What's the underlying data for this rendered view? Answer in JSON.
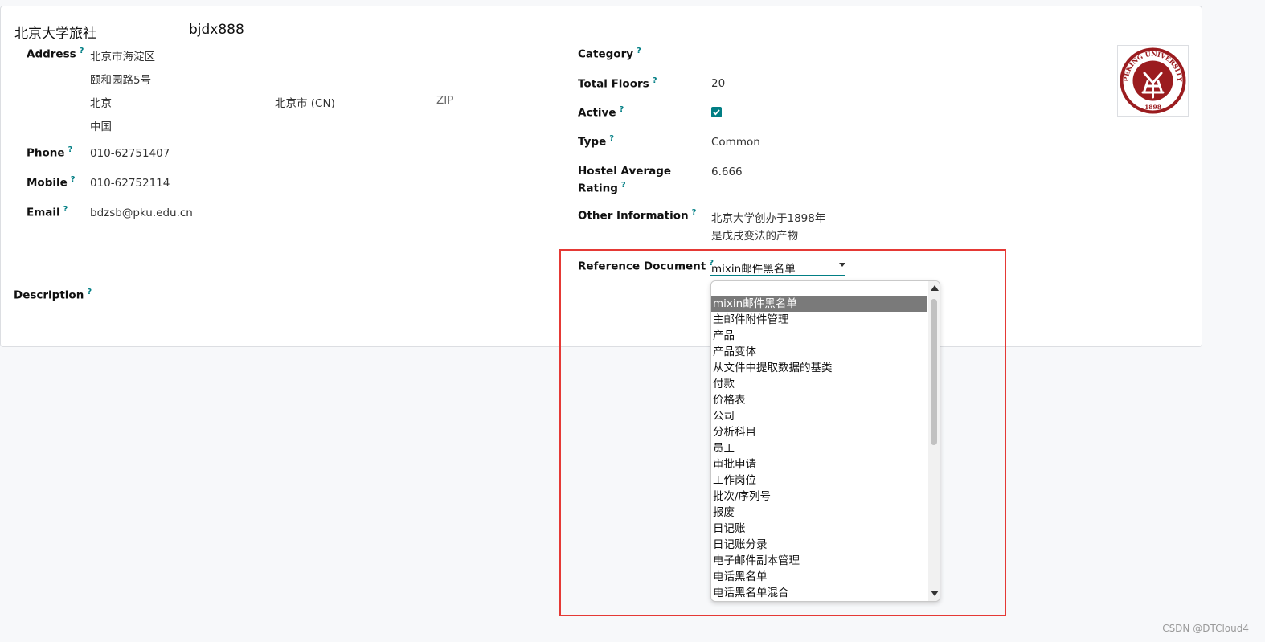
{
  "record": {
    "name": "北京大学旅社",
    "code": "bjdx888"
  },
  "left": {
    "address_label": "Address",
    "address_line1": "北京市海淀区",
    "address_line2": "颐和园路5号",
    "city": "北京",
    "state": "北京市 (CN)",
    "zip_placeholder": "ZIP",
    "country": "中国",
    "phone_label": "Phone",
    "phone": "010-62751407",
    "mobile_label": "Mobile",
    "mobile": "010-62752114",
    "email_label": "Email",
    "email": "bdzsb@pku.edu.cn",
    "description_label": "Description"
  },
  "right": {
    "category_label": "Category",
    "floors_label": "Total Floors",
    "floors": "20",
    "active_label": "Active",
    "active": true,
    "type_label": "Type",
    "type": "Common",
    "rating_label_line1": "Hostel Average",
    "rating_label_line2": "Rating",
    "rating": "6.666",
    "other_label": "Other Information",
    "other_line1": "北京大学创办于1898年",
    "other_line2": "是戊戌变法的产物",
    "ref_label": "Reference Document",
    "ref_value": "mixin邮件黑名单"
  },
  "help_mark": "?",
  "dropdown": {
    "options": [
      "mixin邮件黑名单",
      "主邮件附件管理",
      "产品",
      "产品变体",
      "从文件中提取数据的基类",
      "付款",
      "价格表",
      "公司",
      "分析科目",
      "员工",
      "审批申请",
      "工作岗位",
      "批次/序列号",
      "报废",
      "日记账",
      "日记账分录",
      "电子邮件副本管理",
      "电话黑名单",
      "电话黑名单混合"
    ],
    "selected_index": 0
  },
  "logo": {
    "text": "PEKING UNIVERSITY",
    "year": "1898",
    "color": "#9b1c1f"
  },
  "colors": {
    "accent": "#017e84",
    "highlight_box": "#e53935"
  },
  "watermark": "CSDN @DTCloud4"
}
